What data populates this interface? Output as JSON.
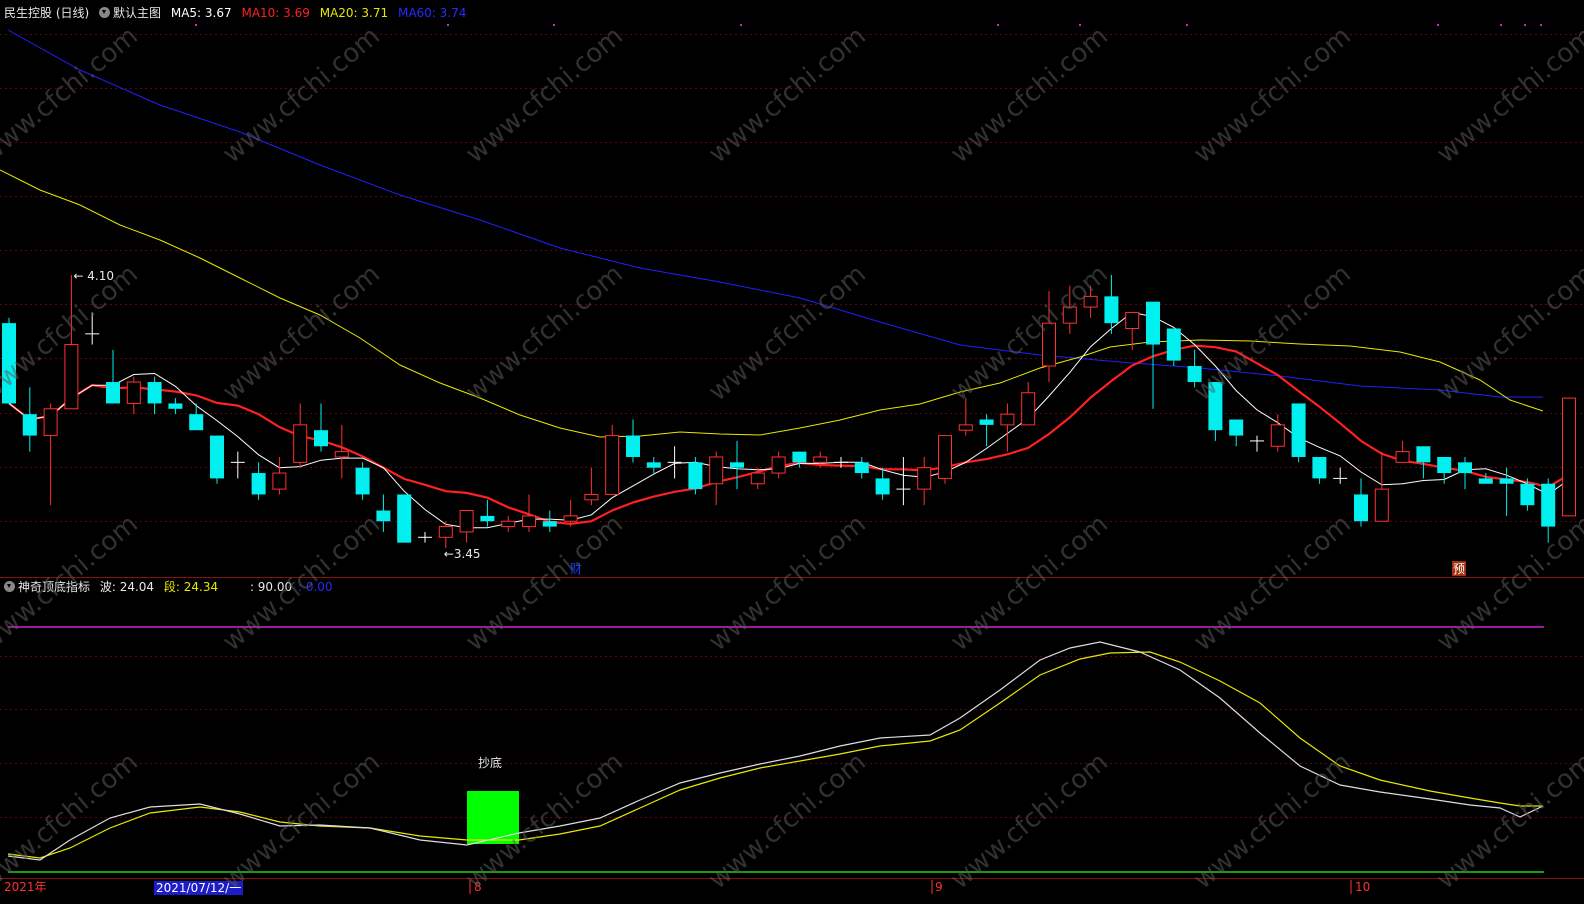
{
  "main_panel": {
    "stock_name": "民生控股 (日线)",
    "template": "默认主图",
    "ma_labels": [
      {
        "label": "MA5: 3.67",
        "color": "#ffffff"
      },
      {
        "label": "MA10: 3.69",
        "color": "#ff2020"
      },
      {
        "label": "MA20: 3.71",
        "color": "#e8e800"
      },
      {
        "label": "MA60: 3.74",
        "color": "#2a2aff"
      }
    ],
    "high_label": "4.10",
    "low_label": "3.45",
    "event_markers": [
      {
        "label": "财",
        "color": "#1a3cff"
      },
      {
        "label": "预",
        "color": "#ff4020"
      }
    ]
  },
  "sub_panel": {
    "indicator_name": "神奇顶底指标",
    "wave_label": "波: 24.04",
    "segment_label": "段: 24.34",
    "level_label": ": 90.00",
    "level2_label": ": 0.00",
    "signal_label": "抄底"
  },
  "time_axis": {
    "year_label": "2021年",
    "cursor_date": "2021/07/12/一",
    "month_labels": [
      "8",
      "9",
      "10"
    ]
  },
  "watermark": "www.cfchi.com",
  "colors": {
    "up": "#ff3030",
    "down": "#00f0f0",
    "ma5": "#ffffff",
    "ma10": "#ff2020",
    "ma20": "#e8e800",
    "ma60": "#2020ff"
  },
  "chart_data": {
    "type": "candlestick",
    "y_range": [
      3.45,
      4.1
    ],
    "candles": [
      {
        "o": 3.87,
        "c": 3.72,
        "h": 3.88,
        "l": 3.72
      },
      {
        "o": 3.7,
        "c": 3.66,
        "h": 3.75,
        "l": 3.63
      },
      {
        "o": 3.66,
        "c": 3.71,
        "h": 3.72,
        "l": 3.53
      },
      {
        "o": 3.71,
        "c": 3.83,
        "h": 3.96,
        "l": 3.71
      },
      {
        "o": 3.85,
        "c": 3.85,
        "h": 3.89,
        "l": 3.83
      },
      {
        "o": 3.76,
        "c": 3.72,
        "h": 3.82,
        "l": 3.72
      },
      {
        "o": 3.72,
        "c": 3.76,
        "h": 3.77,
        "l": 3.7
      },
      {
        "o": 3.76,
        "c": 3.72,
        "h": 3.77,
        "l": 3.7
      },
      {
        "o": 3.72,
        "c": 3.71,
        "h": 3.73,
        "l": 3.7
      },
      {
        "o": 3.7,
        "c": 3.67,
        "h": 3.72,
        "l": 3.67
      },
      {
        "o": 3.66,
        "c": 3.58,
        "h": 3.66,
        "l": 3.57
      },
      {
        "o": 3.61,
        "c": 3.61,
        "h": 3.63,
        "l": 3.58
      },
      {
        "o": 3.59,
        "c": 3.55,
        "h": 3.61,
        "l": 3.54
      },
      {
        "o": 3.56,
        "c": 3.59,
        "h": 3.62,
        "l": 3.55
      },
      {
        "o": 3.61,
        "c": 3.68,
        "h": 3.72,
        "l": 3.6
      },
      {
        "o": 3.67,
        "c": 3.64,
        "h": 3.72,
        "l": 3.63
      },
      {
        "o": 3.62,
        "c": 3.63,
        "h": 3.68,
        "l": 3.58
      },
      {
        "o": 3.6,
        "c": 3.55,
        "h": 3.61,
        "l": 3.54
      },
      {
        "o": 3.52,
        "c": 3.5,
        "h": 3.55,
        "l": 3.48
      },
      {
        "o": 3.55,
        "c": 3.46,
        "h": 3.55,
        "l": 3.46
      },
      {
        "o": 3.47,
        "c": 3.47,
        "h": 3.48,
        "l": 3.46
      },
      {
        "o": 3.47,
        "c": 3.49,
        "h": 3.5,
        "l": 3.45
      },
      {
        "o": 3.48,
        "c": 3.52,
        "h": 3.52,
        "l": 3.46
      },
      {
        "o": 3.51,
        "c": 3.5,
        "h": 3.54,
        "l": 3.49
      },
      {
        "o": 3.49,
        "c": 3.5,
        "h": 3.51,
        "l": 3.48
      },
      {
        "o": 3.49,
        "c": 3.51,
        "h": 3.55,
        "l": 3.48
      },
      {
        "o": 3.5,
        "c": 3.49,
        "h": 3.52,
        "l": 3.48
      },
      {
        "o": 3.5,
        "c": 3.51,
        "h": 3.54,
        "l": 3.49
      },
      {
        "o": 3.54,
        "c": 3.55,
        "h": 3.6,
        "l": 3.53
      },
      {
        "o": 3.55,
        "c": 3.66,
        "h": 3.68,
        "l": 3.55
      },
      {
        "o": 3.66,
        "c": 3.62,
        "h": 3.69,
        "l": 3.61
      },
      {
        "o": 3.61,
        "c": 3.6,
        "h": 3.62,
        "l": 3.59
      },
      {
        "o": 3.61,
        "c": 3.61,
        "h": 3.64,
        "l": 3.58
      },
      {
        "o": 3.61,
        "c": 3.56,
        "h": 3.62,
        "l": 3.55
      },
      {
        "o": 3.57,
        "c": 3.62,
        "h": 3.63,
        "l": 3.53
      },
      {
        "o": 3.61,
        "c": 3.6,
        "h": 3.65,
        "l": 3.56
      },
      {
        "o": 3.57,
        "c": 3.59,
        "h": 3.6,
        "l": 3.56
      },
      {
        "o": 3.59,
        "c": 3.62,
        "h": 3.63,
        "l": 3.58
      },
      {
        "o": 3.63,
        "c": 3.61,
        "h": 3.63,
        "l": 3.6
      },
      {
        "o": 3.61,
        "c": 3.62,
        "h": 3.63,
        "l": 3.6
      },
      {
        "o": 3.61,
        "c": 3.61,
        "h": 3.62,
        "l": 3.6
      },
      {
        "o": 3.61,
        "c": 3.59,
        "h": 3.62,
        "l": 3.58
      },
      {
        "o": 3.58,
        "c": 3.55,
        "h": 3.6,
        "l": 3.54
      },
      {
        "o": 3.56,
        "c": 3.56,
        "h": 3.62,
        "l": 3.53
      },
      {
        "o": 3.56,
        "c": 3.6,
        "h": 3.62,
        "l": 3.53
      },
      {
        "o": 3.58,
        "c": 3.66,
        "h": 3.66,
        "l": 3.57
      },
      {
        "o": 3.67,
        "c": 3.68,
        "h": 3.73,
        "l": 3.66
      },
      {
        "o": 3.69,
        "c": 3.68,
        "h": 3.7,
        "l": 3.64
      },
      {
        "o": 3.68,
        "c": 3.7,
        "h": 3.72,
        "l": 3.63
      },
      {
        "o": 3.68,
        "c": 3.74,
        "h": 3.76,
        "l": 3.68
      },
      {
        "o": 3.79,
        "c": 3.87,
        "h": 3.93,
        "l": 3.76
      },
      {
        "o": 3.87,
        "c": 3.9,
        "h": 3.94,
        "l": 3.85
      },
      {
        "o": 3.9,
        "c": 3.92,
        "h": 3.94,
        "l": 3.88
      },
      {
        "o": 3.92,
        "c": 3.87,
        "h": 3.96,
        "l": 3.85
      },
      {
        "o": 3.86,
        "c": 3.89,
        "h": 3.89,
        "l": 3.82
      },
      {
        "o": 3.91,
        "c": 3.83,
        "h": 3.91,
        "l": 3.71
      },
      {
        "o": 3.86,
        "c": 3.8,
        "h": 3.8,
        "l": 3.79
      },
      {
        "o": 3.79,
        "c": 3.76,
        "h": 3.82,
        "l": 3.75
      },
      {
        "o": 3.76,
        "c": 3.67,
        "h": 3.76,
        "l": 3.65
      },
      {
        "o": 3.69,
        "c": 3.66,
        "h": 3.69,
        "l": 3.64
      },
      {
        "o": 3.65,
        "c": 3.65,
        "h": 3.66,
        "l": 3.63
      },
      {
        "o": 3.64,
        "c": 3.68,
        "h": 3.7,
        "l": 3.63
      },
      {
        "o": 3.72,
        "c": 3.62,
        "h": 3.72,
        "l": 3.61
      },
      {
        "o": 3.62,
        "c": 3.58,
        "h": 3.62,
        "l": 3.57
      },
      {
        "o": 3.58,
        "c": 3.58,
        "h": 3.6,
        "l": 3.57
      },
      {
        "o": 3.55,
        "c": 3.5,
        "h": 3.58,
        "l": 3.49
      },
      {
        "o": 3.5,
        "c": 3.56,
        "h": 3.63,
        "l": 3.5
      },
      {
        "o": 3.61,
        "c": 3.63,
        "h": 3.65,
        "l": 3.61
      },
      {
        "o": 3.64,
        "c": 3.61,
        "h": 3.64,
        "l": 3.58
      },
      {
        "o": 3.62,
        "c": 3.59,
        "h": 3.62,
        "l": 3.57
      },
      {
        "o": 3.61,
        "c": 3.59,
        "h": 3.62,
        "l": 3.56
      },
      {
        "o": 3.58,
        "c": 3.57,
        "h": 3.59,
        "l": 3.57
      },
      {
        "o": 3.58,
        "c": 3.57,
        "h": 3.6,
        "l": 3.51
      },
      {
        "o": 3.57,
        "c": 3.53,
        "h": 3.58,
        "l": 3.52
      },
      {
        "o": 3.57,
        "c": 3.49,
        "h": 3.58,
        "l": 3.46
      },
      {
        "o": 3.51,
        "c": 3.73,
        "h": 3.73,
        "l": 3.51
      }
    ]
  }
}
